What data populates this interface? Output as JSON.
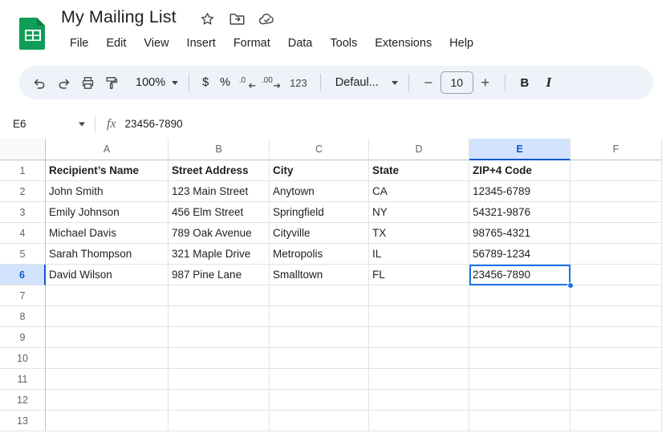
{
  "app": {
    "logo_icon": "google-sheets-logo",
    "doc_title": "My Mailing List"
  },
  "title_icons": [
    {
      "name": "star-icon",
      "label": "Star"
    },
    {
      "name": "move-to-folder-icon",
      "label": "Move"
    },
    {
      "name": "cloud-saved-icon",
      "label": "Saved to Drive"
    }
  ],
  "menubar": {
    "items": [
      {
        "label": "File"
      },
      {
        "label": "Edit"
      },
      {
        "label": "View"
      },
      {
        "label": "Insert"
      },
      {
        "label": "Format"
      },
      {
        "label": "Data"
      },
      {
        "label": "Tools"
      },
      {
        "label": "Extensions"
      },
      {
        "label": "Help"
      }
    ]
  },
  "toolbar": {
    "undo_icon": "undo-icon",
    "redo_icon": "redo-icon",
    "print_icon": "print-icon",
    "paint_format_icon": "paint-format-icon",
    "zoom_value": "100%",
    "currency_label": "$",
    "percent_label": "%",
    "decrease_decimal_icon": "decrease-decimal-icon",
    "decrease_decimal_label": ".0",
    "increase_decimal_icon": "increase-decimal-icon",
    "increase_decimal_label": ".00",
    "more_formats_label": "123",
    "font_name": "Defaul...",
    "font_size_decrease": "−",
    "font_size_value": "10",
    "font_size_increase": "+",
    "bold_label": "B",
    "italic_label": "I"
  },
  "formula_bar": {
    "name_box_value": "E6",
    "fx_label": "fx",
    "formula_value": "23456-7890"
  },
  "grid": {
    "columns": [
      "A",
      "B",
      "C",
      "D",
      "E",
      "F"
    ],
    "selected_column": "E",
    "rows": [
      "1",
      "2",
      "3",
      "4",
      "5",
      "6",
      "7",
      "8",
      "9",
      "10",
      "11",
      "12",
      "13"
    ],
    "selected_row": "6",
    "selected_cell": "E6",
    "accent_color": "#1a73e8",
    "header_highlight_color": "#d3e3fd",
    "data": [
      [
        "Recipient’s Name",
        "Street Address",
        "City",
        "State",
        "ZIP+4 Code",
        ""
      ],
      [
        "John Smith",
        "123 Main Street",
        "Anytown",
        "CA",
        "12345-6789",
        ""
      ],
      [
        "Emily Johnson",
        "456 Elm Street",
        "Springfield",
        "NY",
        "54321-9876",
        ""
      ],
      [
        "Michael Davis",
        "789 Oak Avenue",
        "Cityville",
        "TX",
        "98765-4321",
        ""
      ],
      [
        "Sarah Thompson",
        "321 Maple Drive",
        "Metropolis",
        "IL",
        "56789-1234",
        ""
      ],
      [
        "David Wilson",
        "987 Pine Lane",
        "Smalltown",
        "FL",
        "23456-7890",
        ""
      ],
      [
        "",
        "",
        "",
        "",
        "",
        ""
      ],
      [
        "",
        "",
        "",
        "",
        "",
        ""
      ],
      [
        "",
        "",
        "",
        "",
        "",
        ""
      ],
      [
        "",
        "",
        "",
        "",
        "",
        ""
      ],
      [
        "",
        "",
        "",
        "",
        "",
        ""
      ],
      [
        "",
        "",
        "",
        "",
        "",
        ""
      ],
      [
        "",
        "",
        "",
        "",
        "",
        ""
      ]
    ]
  }
}
